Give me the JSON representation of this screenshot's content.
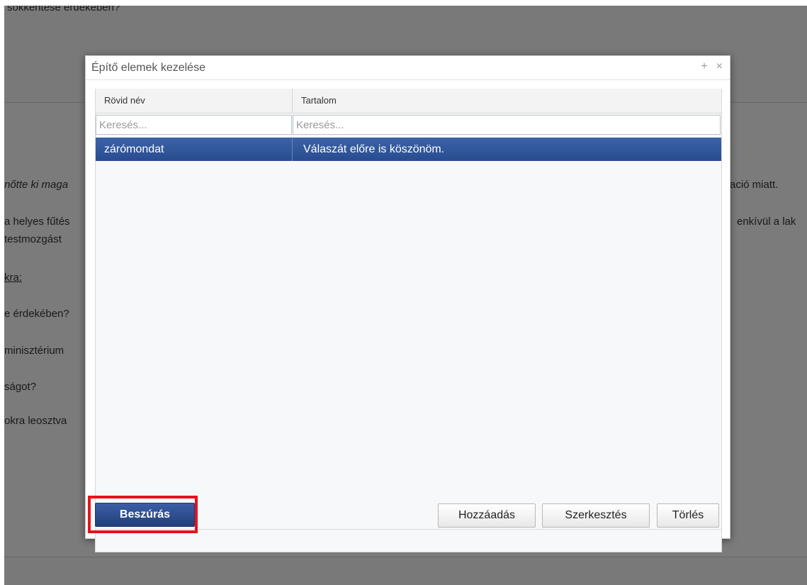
{
  "background": {
    "lines": [
      "sokkentése érdekében?",
      "nőtte ki maga",
      "ació miatt.",
      "a helyes fűtés",
      "enkívül a lak",
      "testmozgást",
      "kra:",
      "e érdekében?",
      "minisztérium",
      "ságot?",
      "okra leosztva"
    ]
  },
  "dialog": {
    "title": "Építő elemek kezelése",
    "controls": {
      "maximize": "+",
      "close": "×"
    },
    "table": {
      "columns": [
        "Rövid név",
        "Tartalom"
      ],
      "filter_placeholder": "Keresés...",
      "rows": [
        {
          "short_name": "zárómondat",
          "content": "Válaszát előre is köszönöm."
        }
      ]
    },
    "buttons": {
      "insert": "Beszúrás",
      "add": "Hozzáadás",
      "edit": "Szerkesztés",
      "delete": "Törlés"
    }
  },
  "colors": {
    "accent": "#2f5597",
    "highlight": "#e8121b"
  }
}
